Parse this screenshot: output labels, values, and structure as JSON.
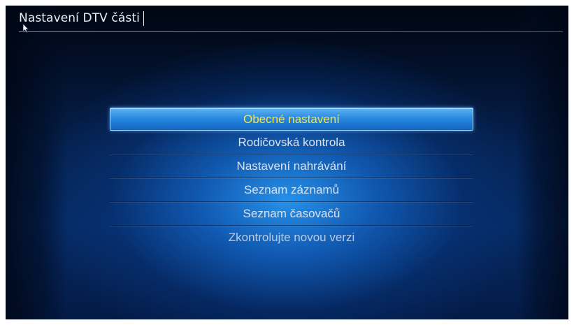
{
  "header": {
    "title": "Nastavení DTV části"
  },
  "menu": {
    "items": [
      {
        "label": "Obecné nastavení",
        "selected": true
      },
      {
        "label": "Rodičovská kontrola",
        "selected": false
      },
      {
        "label": "Nastavení nahrávání",
        "selected": false
      },
      {
        "label": "Seznam záznamů",
        "selected": false
      },
      {
        "label": "Seznam časovačů",
        "selected": false
      },
      {
        "label": "Zkontrolujte novou verzi",
        "selected": false
      }
    ]
  },
  "colors": {
    "selected_text": "#fbe33c",
    "text": "#d8e3f2",
    "highlight": "#2e8ee3",
    "background": "#062a63"
  },
  "icons": {
    "pointer": "mouse-pointer-icon"
  }
}
